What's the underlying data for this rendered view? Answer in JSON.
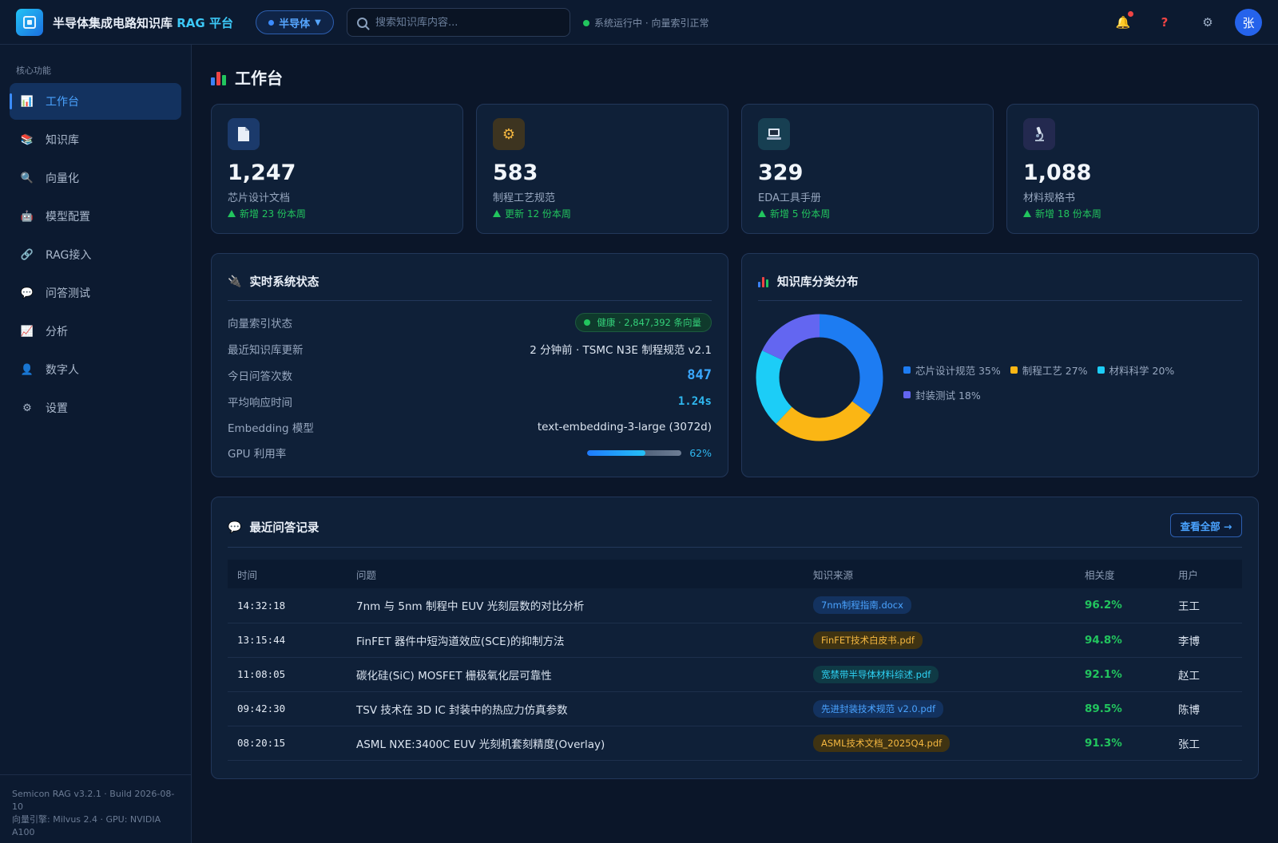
{
  "header": {
    "title_main": "半导体集成电路知识库",
    "title_accent": "RAG 平台",
    "domain_selector": "半导体",
    "search_placeholder": "搜索知识库内容...",
    "system_status": "系统运行中 · 向量索引正常",
    "avatar_text": "张"
  },
  "sidebar": {
    "section_label": "核心功能",
    "items": [
      {
        "label": "工作台",
        "icon": "chart-icon",
        "active": true
      },
      {
        "label": "知识库",
        "icon": "books-icon"
      },
      {
        "label": "向量化",
        "icon": "magnifier-icon"
      },
      {
        "label": "模型配置",
        "icon": "robot-icon"
      },
      {
        "label": "RAG接入",
        "icon": "link-icon"
      },
      {
        "label": "问答测试",
        "icon": "chat-icon"
      },
      {
        "label": "分析",
        "icon": "trend-icon"
      },
      {
        "label": "数字人",
        "icon": "person-icon"
      },
      {
        "label": "设置",
        "icon": "gear-icon"
      }
    ],
    "footer_line1": "Semicon RAG v3.2.1 · Build 2026-08-10",
    "footer_line2": "向量引擎: Milvus 2.4 · GPU: NVIDIA A100"
  },
  "page": {
    "title": "工作台"
  },
  "stats": [
    {
      "value": "1,247",
      "label": "芯片设计文档",
      "trend": "新增 23 份本周",
      "icon": "document-icon",
      "color": "#1b3a6b"
    },
    {
      "value": "583",
      "label": "制程工艺规范",
      "trend": "更新 12 份本周",
      "icon": "gear-icon",
      "color": "#3d3420"
    },
    {
      "value": "329",
      "label": "EDA工具手册",
      "trend": "新增 5 份本周",
      "icon": "laptop-icon",
      "color": "#173f52"
    },
    {
      "value": "1,088",
      "label": "材料规格书",
      "trend": "新增 18 份本周",
      "icon": "microscope-icon",
      "color": "#23294f"
    }
  ],
  "system_status": {
    "title": "实时系统状态",
    "rows": {
      "vector_index": {
        "label": "向量索引状态",
        "value": "健康 · 2,847,392 条向量"
      },
      "kb_update": {
        "label": "最近知识库更新",
        "value": "2 分钟前 · TSMC N3E 制程规范 v2.1"
      },
      "qa_count": {
        "label": "今日问答次数",
        "value": "847"
      },
      "latency": {
        "label": "平均响应时间",
        "value": "1.24s"
      },
      "embedding": {
        "label": "Embedding 模型",
        "value": "text-embedding-3-large (3072d)"
      },
      "gpu": {
        "label": "GPU 利用率",
        "value": "62%",
        "fraction": 0.62
      }
    }
  },
  "distribution": {
    "title": "知识库分类分布"
  },
  "chart_data": {
    "type": "pie",
    "title": "知识库分类分布",
    "categories": [
      "芯片设计规范",
      "制程工艺",
      "材料科学",
      "封装测试"
    ],
    "values": [
      35,
      27,
      20,
      18
    ],
    "legend_labels": [
      "芯片设计规范 35%",
      "制程工艺 27%",
      "材料科学 20%",
      "封装测试 18%"
    ],
    "colors": [
      "#1d7cf2",
      "#fbb614",
      "#1ccdf7",
      "#6366f1"
    ],
    "legend": "right"
  },
  "recent_qa": {
    "title": "最近问答记录",
    "view_all": "查看全部 →",
    "columns": [
      "时间",
      "问题",
      "知识来源",
      "相关度",
      "用户"
    ],
    "rows": [
      {
        "time": "14:32:18",
        "question": "7nm 与 5nm 制程中 EUV 光刻层数的对比分析",
        "source": "7nm制程指南.docx",
        "source_color": "blue",
        "score": "96.2%",
        "user": "王工"
      },
      {
        "time": "13:15:44",
        "question": "FinFET 器件中短沟道效应(SCE)的抑制方法",
        "source": "FinFET技术白皮书.pdf",
        "source_color": "orange",
        "score": "94.8%",
        "user": "李博"
      },
      {
        "time": "11:08:05",
        "question": "碳化硅(SiC) MOSFET 栅极氧化层可靠性",
        "source": "宽禁带半导体材料综述.pdf",
        "source_color": "cyan",
        "score": "92.1%",
        "user": "赵工"
      },
      {
        "time": "09:42:30",
        "question": "TSV 技术在 3D IC 封装中的热应力仿真参数",
        "source": "先进封装技术规范 v2.0.pdf",
        "source_color": "blue",
        "score": "89.5%",
        "user": "陈博"
      },
      {
        "time": "08:20:15",
        "question": "ASML NXE:3400C EUV 光刻机套刻精度(Overlay)",
        "source": "ASML技术文档_2025Q4.pdf",
        "source_color": "orange",
        "score": "91.3%",
        "user": "张工"
      }
    ]
  }
}
